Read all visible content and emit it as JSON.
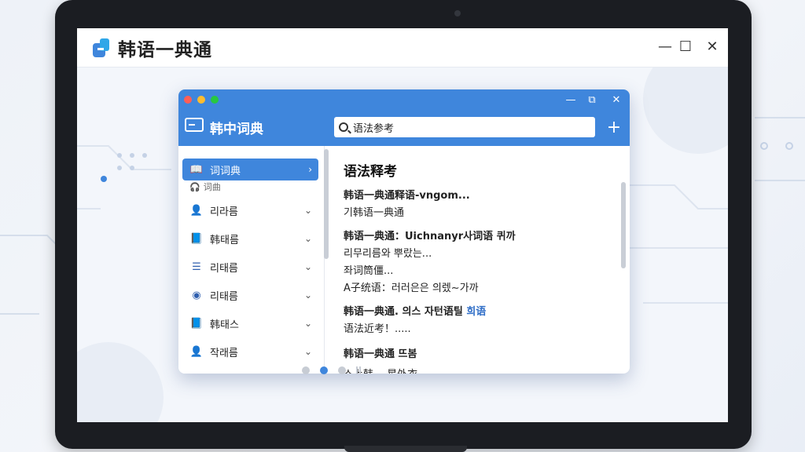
{
  "app": {
    "title": "韩语一典通"
  },
  "window_controls": {
    "minimize": "—",
    "maximize": "☐",
    "close": "✕"
  },
  "inner_window": {
    "app_name": "韩中词典",
    "search": {
      "value": "语法参考"
    },
    "add_label": "+",
    "controls": {
      "minimize": "—",
      "maximize": "⧉",
      "close": "✕"
    },
    "traffic_colors": [
      "#ff5f57",
      "#febc2e",
      "#28c840"
    ]
  },
  "sidebar": {
    "items": [
      {
        "label": "词词典",
        "sub": "词曲",
        "icon": "book-icon",
        "active": true,
        "chevron": "›"
      },
      {
        "label": "리라름",
        "icon": "user-icon",
        "chevron": "⌄"
      },
      {
        "label": "韩태름",
        "icon": "book-icon",
        "chevron": "⌄"
      },
      {
        "label": "리태름",
        "icon": "stack-icon",
        "chevron": "⌄"
      },
      {
        "label": "리태름",
        "icon": "globe-icon",
        "chevron": "⌄"
      },
      {
        "label": "韩태스",
        "icon": "book-icon",
        "chevron": "⌄"
      },
      {
        "label": "작래름",
        "icon": "user-icon",
        "chevron": "⌄"
      }
    ]
  },
  "content": {
    "heading": "语法释考",
    "entries": [
      {
        "text": "韩语一典通释语-vngom...",
        "bold": true
      },
      {
        "text": "기韩语一典通",
        "bold": false
      },
      {
        "text": "韩语一典通：Uichnanyr사词语 퀴까",
        "bold": true
      },
      {
        "text": "리무리름와 뿌랐는...",
        "bold": false
      },
      {
        "text": "좌词筒僵...",
        "bold": false
      },
      {
        "text": "A子统语：러러은은 의렜∼가까",
        "bold": false
      },
      {
        "text_a": "韩语一典通. 의스 자턴语틸 ",
        "text_b": "희语",
        "bold": true
      },
      {
        "text": "语法近考！.....",
        "bold": false
      },
      {
        "text": "韩语一典通 뜨봄",
        "bold": true
      },
      {
        "text": "스上韩… 星外衣",
        "bold": false
      }
    ]
  },
  "pagination": {
    "count": 4,
    "active_index": 1
  }
}
